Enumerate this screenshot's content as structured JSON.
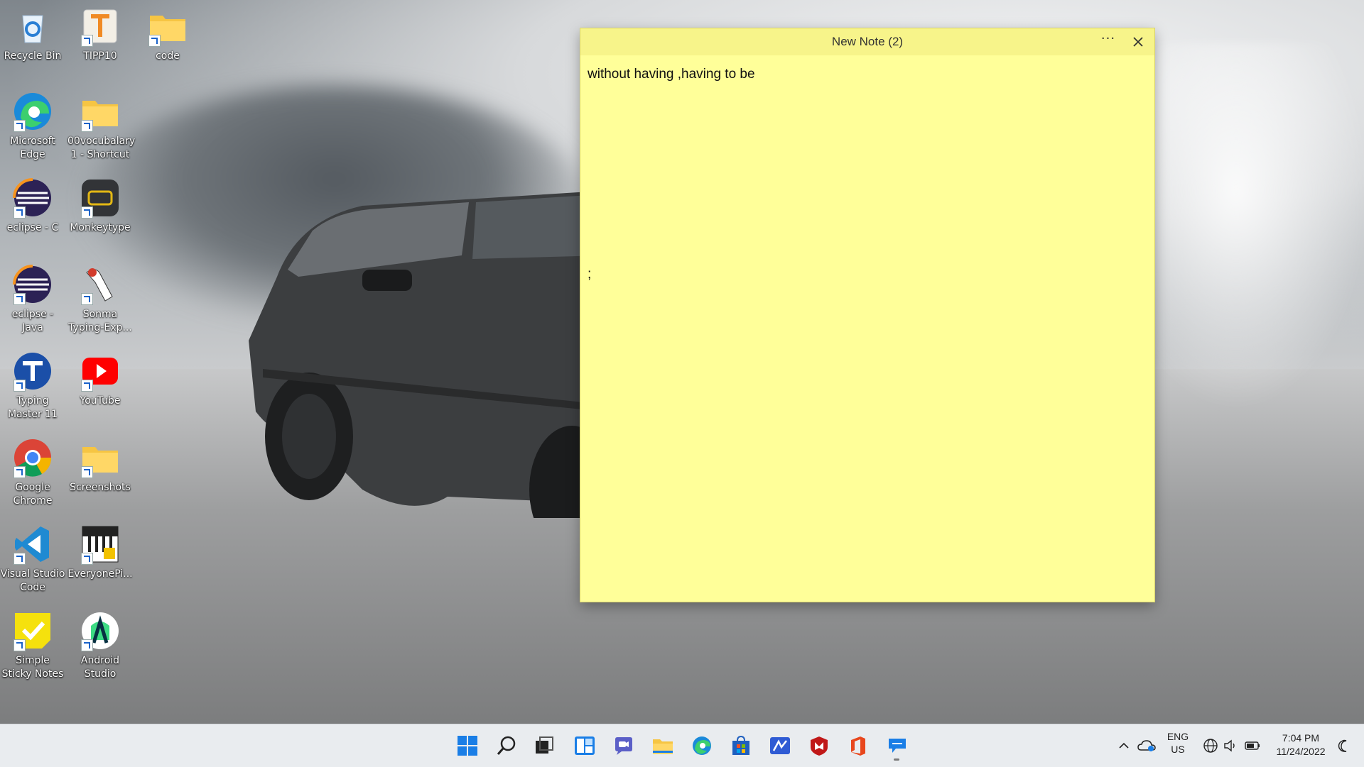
{
  "desktop": {
    "icons": [
      {
        "label": "Recycle Bin",
        "icon": "recycle-bin-icon"
      },
      {
        "label": "TIPP10",
        "icon": "tipp10-icon"
      },
      {
        "label": "code",
        "icon": "folder-icon"
      },
      {
        "label": "Microsoft Edge",
        "icon": "edge-icon"
      },
      {
        "label": "00vocubalary 1 - Shortcut",
        "icon": "folder-icon"
      },
      {
        "label": "eclipse - C",
        "icon": "eclipse-icon"
      },
      {
        "label": "Monkeytype",
        "icon": "monkeytype-icon"
      },
      {
        "label": "eclipse - Java",
        "icon": "eclipse-icon"
      },
      {
        "label": "Sonma Typing-Exp...",
        "icon": "sonma-icon"
      },
      {
        "label": "Typing Master 11",
        "icon": "typing-master-icon"
      },
      {
        "label": "YouTube",
        "icon": "youtube-icon"
      },
      {
        "label": "Google Chrome",
        "icon": "chrome-icon"
      },
      {
        "label": "Screenshots",
        "icon": "folder-icon"
      },
      {
        "label": "Visual Studio Code",
        "icon": "vscode-icon"
      },
      {
        "label": "EveryonePi...",
        "icon": "everyonepiano-icon"
      },
      {
        "label": "Simple Sticky Notes",
        "icon": "sticky-notes-icon"
      },
      {
        "label": "Android Studio",
        "icon": "android-studio-icon"
      }
    ]
  },
  "note": {
    "title": "New Note (2)",
    "more_label": "···",
    "line1": "without having ,having to be",
    "line2": ";",
    "background": "#ffff99"
  },
  "taskbar": {
    "icons": [
      "start-icon",
      "search-icon",
      "task-view-icon",
      "widgets-icon",
      "chat-icon",
      "file-explorer-icon",
      "edge-icon",
      "store-icon",
      "vscode-alt-icon",
      "mcafee-icon",
      "office-icon",
      "sticky-notes-app-icon"
    ],
    "language_top": "ENG",
    "language_bottom": "US",
    "time": "7:04 PM",
    "date": "11/24/2022"
  }
}
